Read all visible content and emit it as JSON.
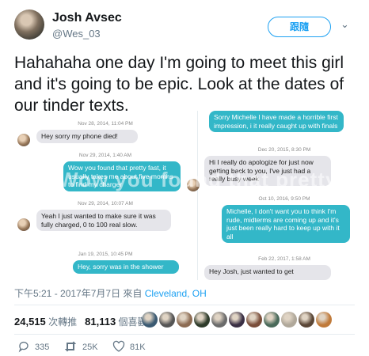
{
  "user": {
    "display_name": "Josh Avsec",
    "handle": "@Wes_03",
    "follow_label": "跟隨"
  },
  "tweet": {
    "text": "Hahahaha one day I'm going to meet this girl and it's going to be epic. Look at the dates of our tinder texts."
  },
  "media": {
    "watermark": "Wow you found that pretty fast",
    "left": {
      "timestamps": [
        "Nov 28, 2014, 11:04 PM",
        "Nov 29, 2014, 1:40 AM",
        "Nov 29, 2014, 10:07 AM",
        "Jan 19, 2015, 10:45 PM"
      ],
      "messages": [
        {
          "from": "her",
          "text": "Hey sorry my phone died!"
        },
        {
          "from": "him",
          "text": "Wow you found that pretty fast, it usually takes me about five months to find my charger"
        },
        {
          "from": "her",
          "text": "Yeah I just wanted to make sure it was fully charged, 0 to 100 real slow."
        },
        {
          "from": "him",
          "text": "Hey, sorry was in the shower"
        }
      ]
    },
    "right": {
      "timestamps": [
        "Dec 20, 2015, 8:30 PM",
        "Oct 10, 2016, 9:50 PM",
        "Feb 22, 2017, 1:58 AM"
      ],
      "messages": [
        {
          "from": "him",
          "text": "Sorry Michelle I have made a horrible first impression, i it really caught up with finals"
        },
        {
          "from": "her",
          "text": "Hi I really do apologize for just now getting back to you, I've just had a really busy week"
        },
        {
          "from": "him",
          "text": "Michelle, I don't want you to think I'm rude, midterms are coming up and it's just been really hard to keep up with it all"
        },
        {
          "from": "her",
          "text": "Hey Josh, just wanted to get"
        }
      ]
    }
  },
  "meta": {
    "timestamp": "下午5:21 - 2017年7月7日 來自",
    "place": "Cleveland, OH"
  },
  "stats": {
    "retweets_count": "24,515",
    "retweets_label": "次轉推",
    "likes_count": "81,113",
    "likes_label": "個喜歡"
  },
  "actions": {
    "reply_count": "335",
    "retweet_count": "25K",
    "like_count": "81K"
  },
  "likers": [
    "#3b5a72",
    "#555555",
    "#8c6b52",
    "#2e3b2a",
    "#6b6b6b",
    "#3a2f44",
    "#7a4e3a",
    "#4a6a5a",
    "#b0a89a",
    "#5a4636",
    "#c07a3a"
  ],
  "colors": {
    "accent": "#1da1f2",
    "bubble_blue": "#33b7c8",
    "bubble_gray": "#e5e5ea"
  }
}
